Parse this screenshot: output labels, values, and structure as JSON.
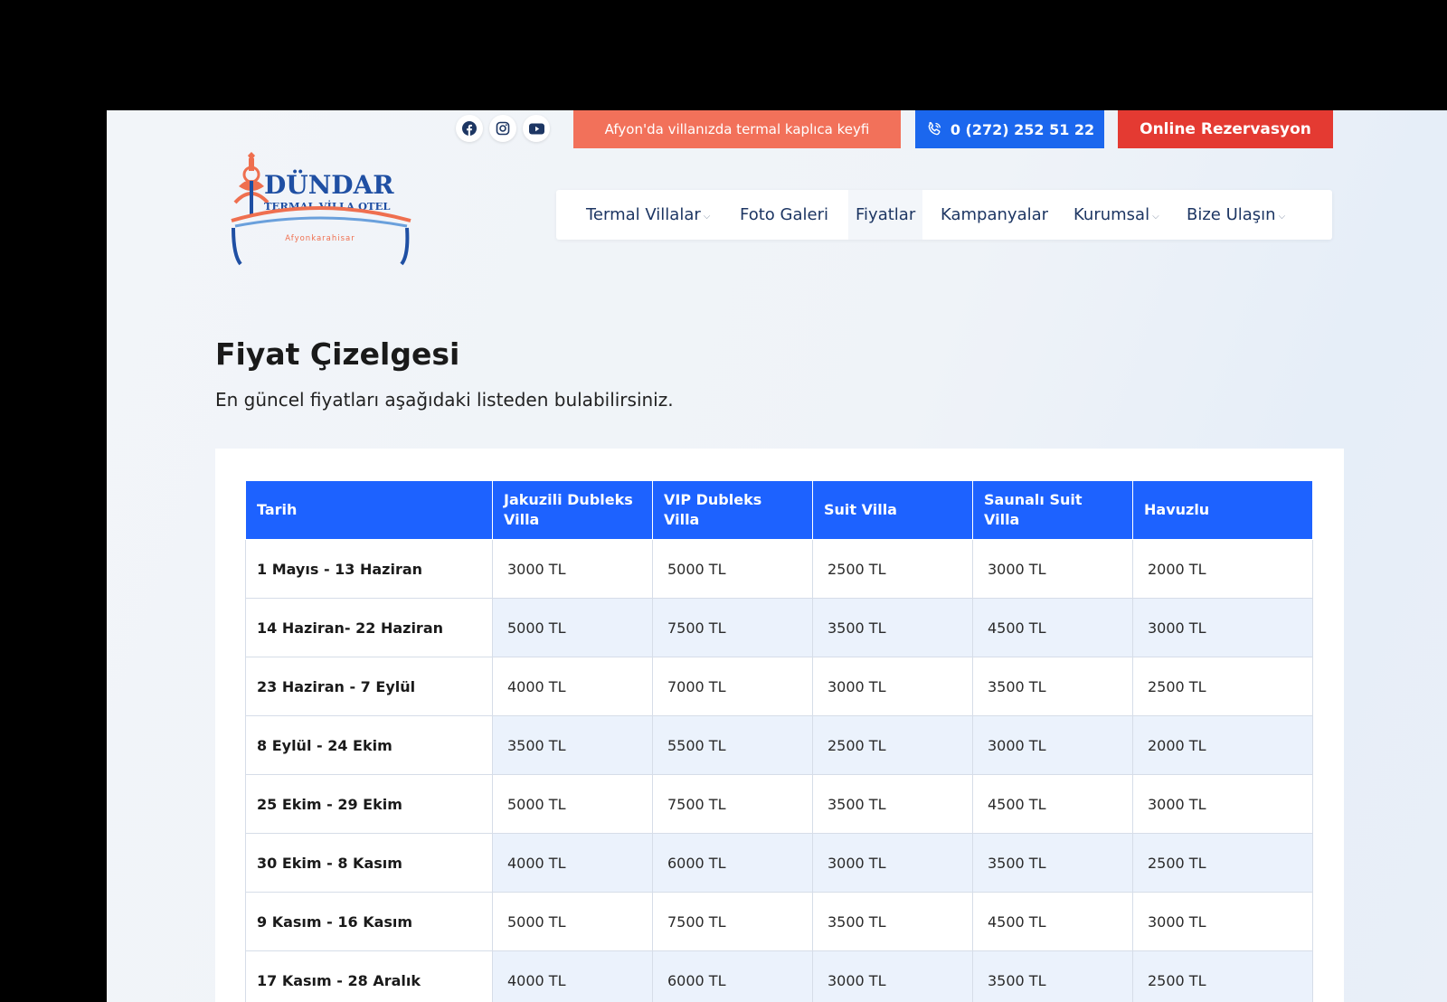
{
  "topbar": {
    "social": [
      "facebook-icon",
      "instagram-icon",
      "youtube-icon"
    ],
    "promo": "Afyon'da villanızda termal kaplıca keyfi",
    "phone": "0 (272) 252 51 22",
    "reserve": "Online Rezervasyon"
  },
  "logo": {
    "name": "DÜNDAR",
    "tagline": "TERMAL VİLLA OTEL",
    "city": "Afyonkarahisar"
  },
  "nav": {
    "items": [
      {
        "label": "Termal Villalar",
        "dropdown": true
      },
      {
        "label": "Foto Galeri",
        "dropdown": false
      },
      {
        "label": "Fiyatlar",
        "dropdown": false,
        "active": true
      },
      {
        "label": "Kampanyalar",
        "dropdown": false
      },
      {
        "label": "Kurumsal",
        "dropdown": true
      },
      {
        "label": "Bize Ulaşın",
        "dropdown": true
      }
    ],
    "caret": "⌵"
  },
  "page": {
    "title": "Fiyat Çizelgesi",
    "subtitle": "En güncel fiyatları aşağıdaki listeden bulabilirsiniz."
  },
  "table": {
    "headers": [
      "Tarih",
      "Jakuzili Dubleks Villa",
      "VIP Dubleks Villa",
      "Suit Villa",
      "Saunalı Suit Villa",
      "Havuzlu"
    ],
    "rows": [
      [
        "1 Mayıs - 13 Haziran",
        "3000 TL",
        "5000 TL",
        "2500 TL",
        "3000 TL",
        "2000 TL"
      ],
      [
        "14 Haziran- 22 Haziran",
        "5000 TL",
        "7500 TL",
        "3500 TL",
        "4500 TL",
        "3000 TL"
      ],
      [
        "23 Haziran - 7 Eylül",
        "4000 TL",
        "7000 TL",
        "3000 TL",
        "3500 TL",
        "2500 TL"
      ],
      [
        "8 Eylül - 24 Ekim",
        "3500 TL",
        "5500 TL",
        "2500 TL",
        "3000 TL",
        "2000 TL"
      ],
      [
        "25 Ekim - 29 Ekim",
        "5000 TL",
        "7500 TL",
        "3500 TL",
        "4500 TL",
        "3000 TL"
      ],
      [
        "30 Ekim - 8 Kasım",
        "4000 TL",
        "6000 TL",
        "3000 TL",
        "3500 TL",
        "2500 TL"
      ],
      [
        "9 Kasım - 16 Kasım",
        "5000 TL",
        "7500 TL",
        "3500 TL",
        "4500 TL",
        "3000 TL"
      ],
      [
        "17 Kasım - 28 Aralık",
        "4000 TL",
        "6000 TL",
        "3000 TL",
        "3500 TL",
        "2500 TL"
      ]
    ]
  },
  "colors": {
    "promo": "#f2715a",
    "phone": "#1b67ee",
    "reserve": "#e43a32",
    "table_header": "#1d62ff",
    "nav_text": "#1d3663",
    "logo_blue": "#1f4fa3",
    "logo_orange": "#ef6f4f"
  }
}
